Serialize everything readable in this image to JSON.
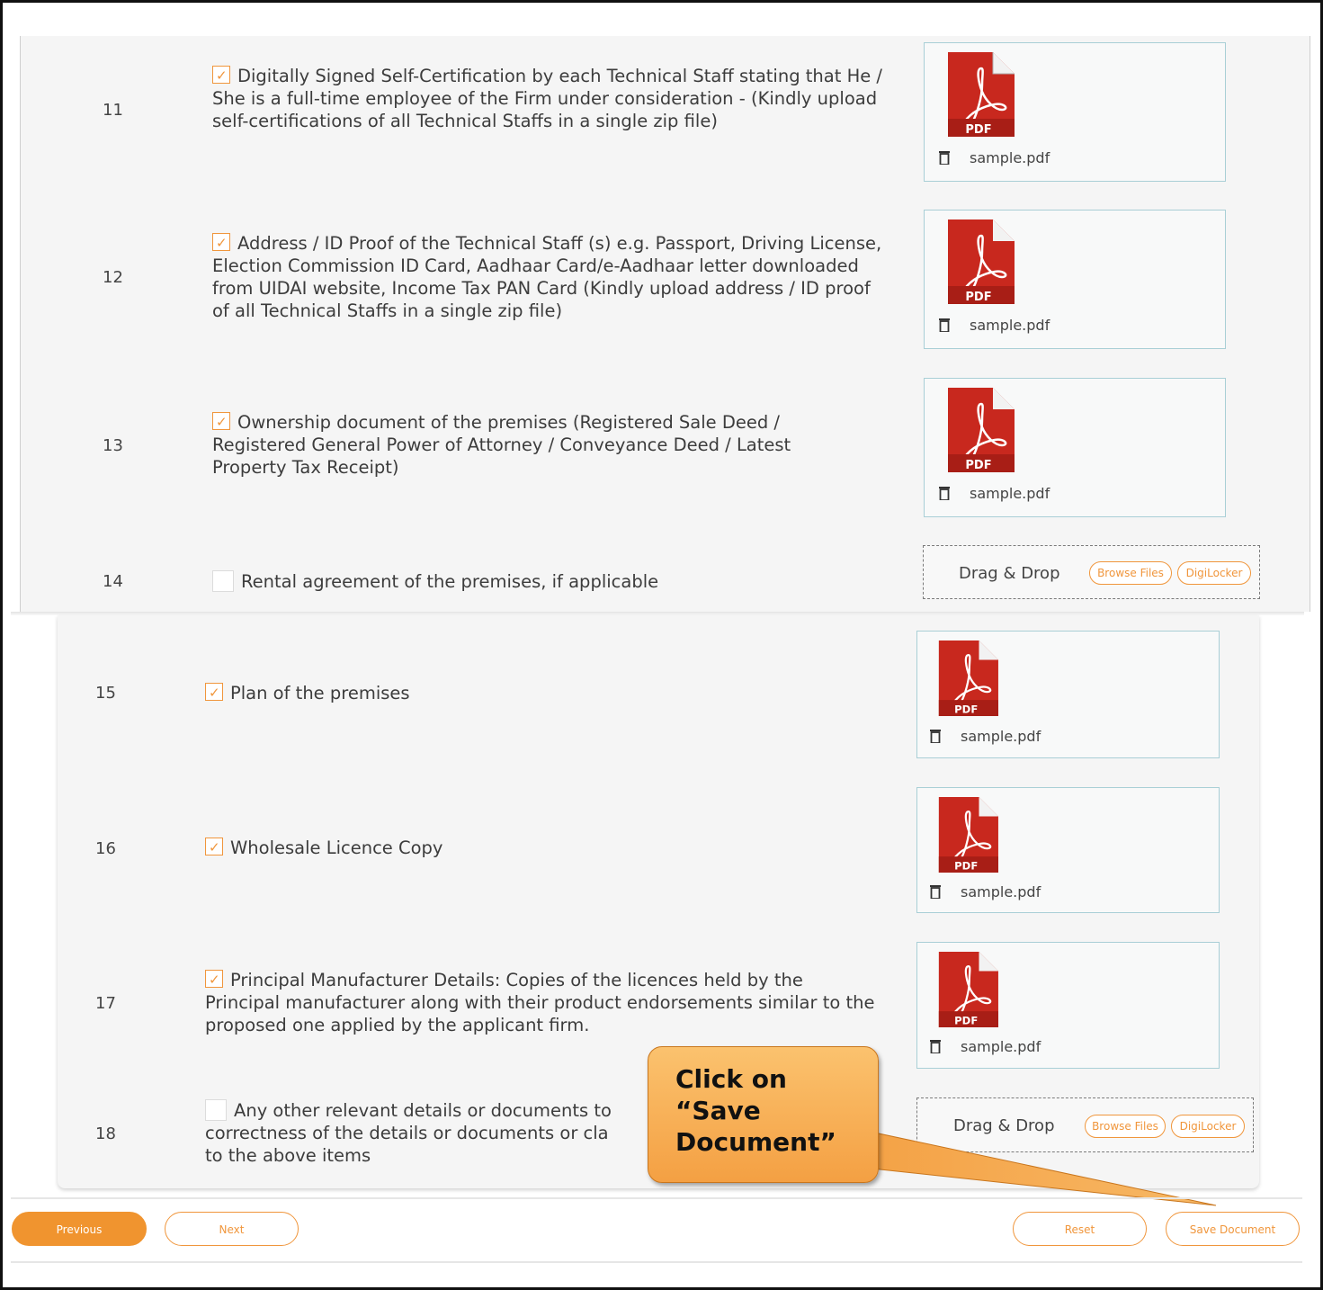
{
  "documents": [
    {
      "num": "11",
      "checked": true,
      "text": "Digitally Signed Self-Certification by each Technical Staff stating that He / She is a full-time employee of the Firm under consideration - (Kindly upload self-certifications of all Technical Staffs in a single zip file)",
      "file": "sample.pdf"
    },
    {
      "num": "12",
      "checked": true,
      "text": "Address / ID Proof of the Technical Staff (s) e.g. Passport, Driving License, Election Commission ID Card, Aadhaar Card/e-Aadhaar letter downloaded from UIDAI website, Income Tax PAN Card (Kindly upload address / ID proof of all Technical Staffs in a single zip file)",
      "file": "sample.pdf"
    },
    {
      "num": "13",
      "checked": true,
      "text": "Ownership document of the premises (Registered Sale Deed / Registered General Power of Attorney / Conveyance Deed / Latest Property Tax Receipt)",
      "file": "sample.pdf"
    },
    {
      "num": "14",
      "checked": false,
      "text": "Rental agreement of the premises, if applicable",
      "file": ""
    },
    {
      "num": "15",
      "checked": true,
      "text": "Plan of the premises",
      "file": "sample.pdf"
    },
    {
      "num": "16",
      "checked": true,
      "text": "Wholesale Licence Copy",
      "file": "sample.pdf"
    },
    {
      "num": "17",
      "checked": true,
      "text": "Principal Manufacturer Details: Copies of the licences held by the Principal manufacturer along with their product endorsements similar to the proposed one applied by the applicant firm.",
      "file": "sample.pdf"
    },
    {
      "num": "18",
      "checked": false,
      "text": "Any other relevant details or documents to",
      "text_line2": "correctness of the details or documents or cla",
      "text_line3": "to the above items",
      "file": ""
    }
  ],
  "pdf_icon_label": "PDF",
  "upload": {
    "drag_drop": "Drag & Drop",
    "browse_files": "Browse Files",
    "digilocker": "DigiLocker"
  },
  "footer": {
    "previous": "Previous",
    "next": "Next",
    "reset": "Reset",
    "save_document": "Save Document"
  },
  "callout": {
    "text_line1": "Click on",
    "text_line2": "“Save",
    "text_line3": "Document”"
  },
  "colors": {
    "accent": "#f0963c",
    "upload_border": "#a9cfd6",
    "pdf_red": "#c8281e",
    "callout": "#f4a043"
  }
}
